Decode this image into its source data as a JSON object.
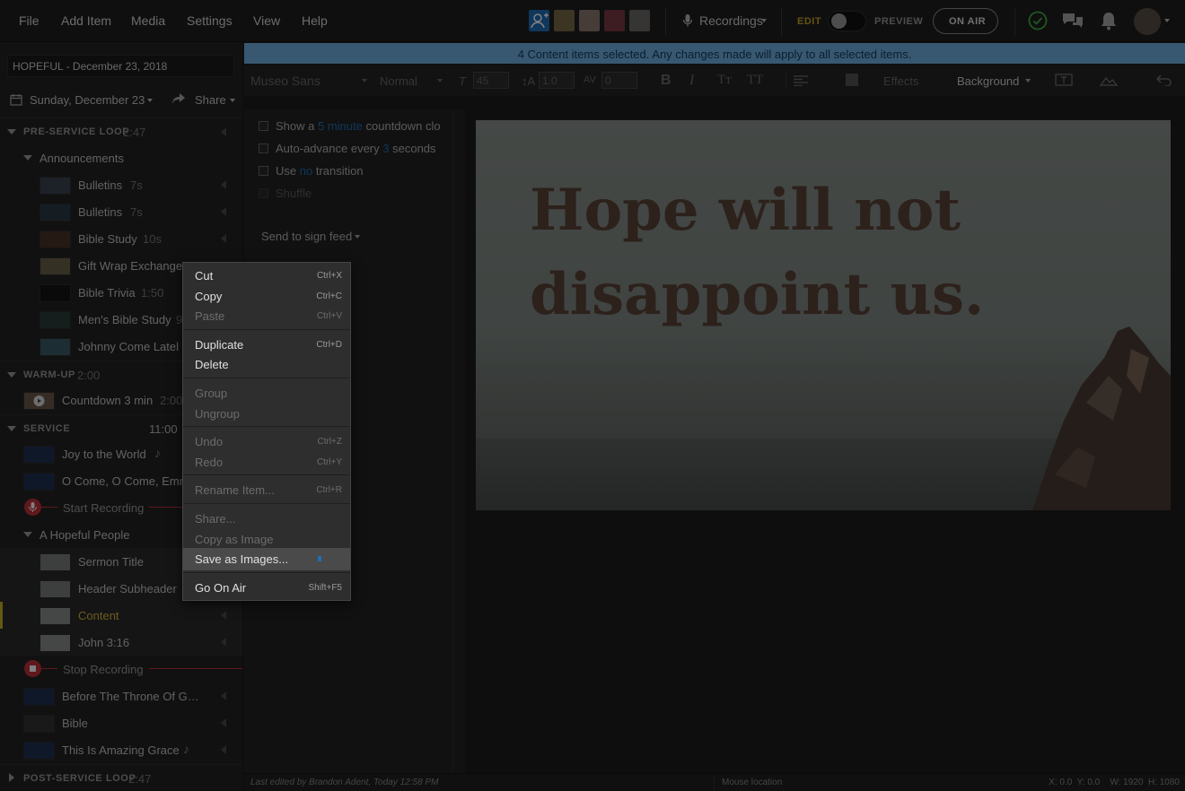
{
  "menu": [
    "File",
    "Add Item",
    "Media",
    "Settings",
    "View",
    "Help"
  ],
  "topbar": {
    "recordings_label": "Recordings",
    "edit_label": "EDIT",
    "preview_label": "PREVIEW",
    "on_air_label": "ON AIR"
  },
  "plan": {
    "title": "HOPEFUL - December 23, 2018",
    "date": "Sunday, December 23",
    "share_label": "Share"
  },
  "sections": {
    "pre_service": {
      "label": "PRE-SERVICE LOOP",
      "time": "2:47"
    },
    "warm_up": {
      "label": "WARM-UP",
      "time": "2:00"
    },
    "service": {
      "label": "SERVICE",
      "time": "11:00"
    },
    "post_service": {
      "label": "POST-SERVICE LOOP",
      "time": "2:47"
    }
  },
  "items": {
    "announcements": "Announcements",
    "bulletins1": {
      "label": "Bulletins",
      "dur": "7s"
    },
    "bulletins2": {
      "label": "Bulletins",
      "dur": "7s"
    },
    "bible_study": {
      "label": "Bible Study",
      "dur": "10s"
    },
    "gift_wrap": {
      "label": "Gift Wrap Exchange"
    },
    "bible_trivia": {
      "label": "Bible Trivia",
      "dur": "1:50"
    },
    "mens_bible": {
      "label": "Men's Bible Study",
      "dur": "9"
    },
    "johnny": {
      "label": "Johnny Come Latel"
    },
    "countdown": {
      "label": "Countdown 3 min",
      "dur": "2:00"
    },
    "joy": {
      "label": "Joy to the World"
    },
    "o_come": {
      "label": "O Come, O Come, Emm"
    },
    "start_rec": "Start Recording",
    "hopeful_people": "A Hopeful People",
    "sermon_title": "Sermon Title",
    "header_sub": "Header Subheader",
    "content": "Content",
    "john316": "John 3:16",
    "stop_rec": "Stop Recording",
    "before_throne": "Before The Throne Of G…",
    "bible": "Bible",
    "amazing_grace": "This Is Amazing Grace"
  },
  "banner": "4 Content items selected. Any changes made will apply to all selected items.",
  "toolbar": {
    "font": "Museo Sans",
    "weight": "Normal",
    "size": "45",
    "line_height": "1.0",
    "letter_spacing": "0",
    "effects": "Effects",
    "background": "Background"
  },
  "options": {
    "countdown_pre": "Show a",
    "countdown_link": "5 minute",
    "countdown_post": "countdown clo",
    "advance_pre": "Auto-advance every",
    "advance_link": "3",
    "advance_post": "seconds",
    "transition_pre": "Use",
    "transition_link": "no",
    "transition_post": "transition",
    "shuffle": "Shuffle",
    "sign_feed": "Send to sign feed"
  },
  "slide": {
    "line1": "Hope will not",
    "line2": "disappoint us."
  },
  "context_menu": {
    "cut": {
      "label": "Cut",
      "shortcut": "Ctrl+X"
    },
    "copy": {
      "label": "Copy",
      "shortcut": "Ctrl+C"
    },
    "paste": {
      "label": "Paste",
      "shortcut": "Ctrl+V"
    },
    "duplicate": {
      "label": "Duplicate",
      "shortcut": "Ctrl+D"
    },
    "delete": {
      "label": "Delete"
    },
    "group": {
      "label": "Group"
    },
    "ungroup": {
      "label": "Ungroup"
    },
    "undo": {
      "label": "Undo",
      "shortcut": "Ctrl+Z"
    },
    "redo": {
      "label": "Redo",
      "shortcut": "Ctrl+Y"
    },
    "rename": {
      "label": "Rename Item...",
      "shortcut": "Ctrl+R"
    },
    "share": {
      "label": "Share..."
    },
    "copy_image": {
      "label": "Copy as Image"
    },
    "save_images": {
      "label": "Save as Images..."
    },
    "go_on_air": {
      "label": "Go On Air",
      "shortcut": "Shift+F5"
    }
  },
  "status": {
    "last_edited": "Last edited by Brandon Adent, Today 12:58 PM",
    "mouse": "Mouse location",
    "coords": "X: 0.0  Y: 0.0    W: 1920  H: 1080"
  },
  "colors": {
    "accent_blue": "#1e6fb8",
    "selected_yellow": "#c9b12a",
    "record_red": "#c0303a",
    "online_green": "#3cb043"
  }
}
